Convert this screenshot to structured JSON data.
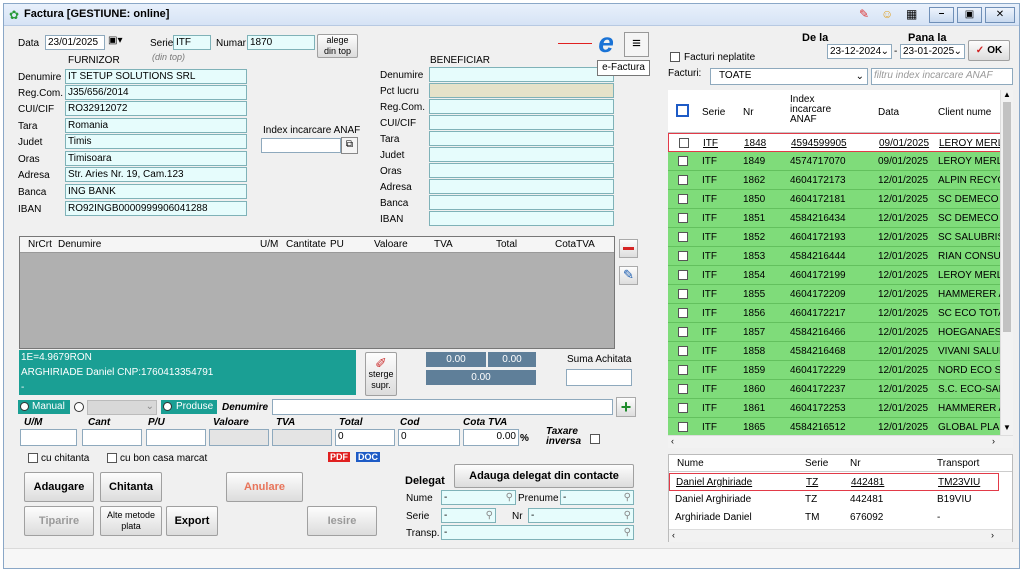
{
  "window": {
    "title": "Factura [GESTIUNE: online]"
  },
  "header": {
    "data_label": "Data",
    "data_value": "23/01/2025",
    "serie_label": "Serie",
    "serie_value": "ITF",
    "numar_label": "Numar",
    "numar_value": "1870",
    "alege_btn": "alege\ndin top",
    "din_top": "(din top)"
  },
  "furnizor": {
    "title": "FURNIZOR",
    "fields": [
      {
        "label": "Denumire",
        "value": "IT SETUP SOLUTIONS SRL"
      },
      {
        "label": "Reg.Com.",
        "value": "J35/656/2014"
      },
      {
        "label": "CUI/CIF",
        "value": "RO32912072"
      },
      {
        "label": "Tara",
        "value": "Romania"
      },
      {
        "label": "Judet",
        "value": "Timis"
      },
      {
        "label": "Oras",
        "value": "Timisoara"
      },
      {
        "label": "Adresa",
        "value": "Str. Aries Nr. 19, Cam.123"
      },
      {
        "label": "Banca",
        "value": "ING BANK"
      },
      {
        "label": "IBAN",
        "value": "RO92INGB0000999906041288"
      }
    ]
  },
  "anaf": {
    "label": "Index incarcare ANAF",
    "value": ""
  },
  "beneficiar": {
    "title": "BENEFICIAR",
    "labels": [
      "Denumire",
      "Pct lucru",
      "Reg.Com.",
      "CUI/CIF",
      "Tara",
      "Judet",
      "Oras",
      "Adresa",
      "Banca",
      "IBAN"
    ]
  },
  "efactura": {
    "tooltip": "e-Factura"
  },
  "items_table": {
    "columns": [
      "NrCrt",
      "Denumire",
      "U/M",
      "Cantitate",
      "PU",
      "Valoare",
      "TVA",
      "Total",
      "CotaTVA"
    ]
  },
  "info": {
    "line1": "1E=4.9679RON",
    "line2": "ARGHIRIADE Daniel CNP:1760413354791",
    "line3": "-"
  },
  "totals": {
    "valoare": "0.00",
    "tva": "0.00",
    "total": "0.00",
    "sterge": "sterge\nsupr.",
    "suma_label": "Suma Achitata"
  },
  "product": {
    "manual": "Manual",
    "produse": "Produse",
    "denumire": "Denumire",
    "cols": [
      "U/M",
      "Cant",
      "P/U",
      "Valoare",
      "TVA",
      "Total",
      "Cod",
      "Cota TVA"
    ],
    "total_val": "0",
    "cod_val": "0",
    "cota_val": "0.00",
    "pct": "%",
    "taxare": "Taxare\ninversa"
  },
  "options": {
    "chitanta": "cu chitanta",
    "bon": "cu bon casa marcat",
    "pdf": "PDF",
    "doc": "DOC"
  },
  "buttons": {
    "adaugare": "Adaugare",
    "chitanta": "Chitanta",
    "anulare": "Anulare",
    "tiparire": "Tiparire",
    "alte": "Alte metode\nplata",
    "export": "Export",
    "iesire": "Iesire"
  },
  "delegat": {
    "title": "Delegat",
    "add_btn": "Adauga delegat din contacte",
    "nume": "Nume",
    "prenume": "Prenume",
    "serie": "Serie",
    "nr": "Nr",
    "transp": "Transp.",
    "dash": "-"
  },
  "filters": {
    "de_la": "De la",
    "pana_la": "Pana la",
    "from": "23-12-2024",
    "to": "23-01-2025",
    "ok": "OK",
    "neplatite": "Facturi neplatite",
    "facturi": "Facturi:",
    "toate": "TOATE",
    "filtru_ph": "filtru index incarcare ANAF"
  },
  "invoices": {
    "columns": [
      "Serie",
      "Nr",
      "Index incarcare ANAF",
      "Data",
      "Client nume"
    ],
    "rows": [
      [
        "ITF",
        "1848",
        "4594599905",
        "09/01/2025",
        "LEROY MERLI"
      ],
      [
        "ITF",
        "1849",
        "4574717070",
        "09/01/2025",
        "LEROY MERLI"
      ],
      [
        "ITF",
        "1862",
        "4604172173",
        "12/01/2025",
        "ALPIN RECYCL"
      ],
      [
        "ITF",
        "1850",
        "4604172181",
        "12/01/2025",
        "SC DEMECO S"
      ],
      [
        "ITF",
        "1851",
        "4584216434",
        "12/01/2025",
        "SC DEMECO S"
      ],
      [
        "ITF",
        "1852",
        "4604172193",
        "12/01/2025",
        "SC SALUBRIS"
      ],
      [
        "ITF",
        "1853",
        "4584216444",
        "12/01/2025",
        "RIAN CONSUL"
      ],
      [
        "ITF",
        "1854",
        "4604172199",
        "12/01/2025",
        "LEROY MERLI"
      ],
      [
        "ITF",
        "1855",
        "4604172209",
        "12/01/2025",
        "HAMMERER A"
      ],
      [
        "ITF",
        "1856",
        "4604172217",
        "12/01/2025",
        "SC ECO TOTA"
      ],
      [
        "ITF",
        "1857",
        "4584216466",
        "12/01/2025",
        "HOEGANAES C"
      ],
      [
        "ITF",
        "1858",
        "4584216468",
        "12/01/2025",
        "VIVANI SALUB"
      ],
      [
        "ITF",
        "1859",
        "4604172229",
        "12/01/2025",
        "NORD ECO SC"
      ],
      [
        "ITF",
        "1860",
        "4604172237",
        "12/01/2025",
        "S.C. ECO-SAL"
      ],
      [
        "ITF",
        "1861",
        "4604172253",
        "12/01/2025",
        "HAMMERER A"
      ],
      [
        "ITF",
        "1865",
        "4584216512",
        "12/01/2025",
        "GLOBAL PLAS"
      ]
    ]
  },
  "delegates": {
    "columns": [
      "Nume",
      "Serie",
      "Nr",
      "Transport"
    ],
    "rows": [
      [
        "Daniel Arghiriade",
        "TZ",
        "442481",
        "TM23VIU"
      ],
      [
        "Daniel Arghiriade",
        "TZ",
        "442481",
        "B19VIU"
      ],
      [
        "Arghiriade Daniel",
        "TM",
        "676092",
        "-"
      ]
    ]
  }
}
